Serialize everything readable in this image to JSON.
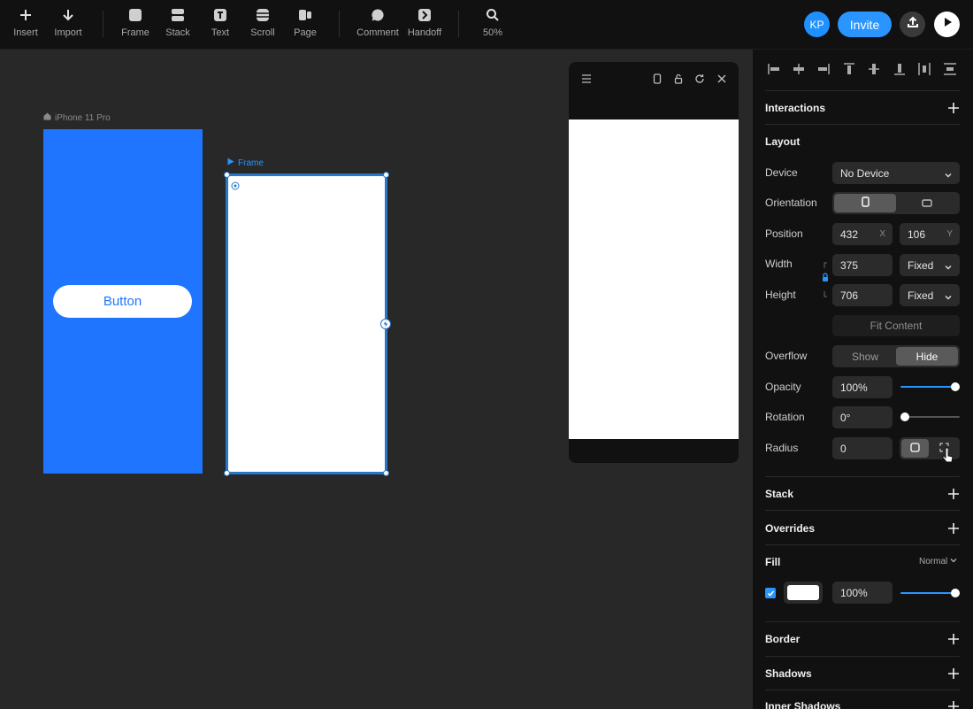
{
  "toolbar": {
    "insert": "Insert",
    "import": "Import",
    "frame": "Frame",
    "stack": "Stack",
    "text": "Text",
    "scroll": "Scroll",
    "page": "Page",
    "comment": "Comment",
    "handoff": "Handoff",
    "zoom": "50%",
    "avatar_initials": "KP",
    "invite": "Invite"
  },
  "canvas": {
    "iphone_frame_title": "iPhone 11 Pro",
    "button_label": "Button",
    "selected_frame_title": "Frame"
  },
  "panel": {
    "interactions": "Interactions",
    "layout": "Layout",
    "device_label": "Device",
    "device_value": "No Device",
    "orientation_label": "Orientation",
    "position_label": "Position",
    "position_x": "432",
    "position_x_suffix": "X",
    "position_y": "106",
    "position_y_suffix": "Y",
    "width_label": "Width",
    "width_value": "375",
    "width_mode": "Fixed",
    "height_label": "Height",
    "height_value": "706",
    "height_mode": "Fixed",
    "fit_content": "Fit Content",
    "overflow_label": "Overflow",
    "overflow_show": "Show",
    "overflow_hide": "Hide",
    "opacity_label": "Opacity",
    "opacity_value": "100%",
    "opacity_level": 1.0,
    "rotation_label": "Rotation",
    "rotation_value": "0°",
    "rotation_level": 0,
    "radius_label": "Radius",
    "radius_value": "0",
    "stack": "Stack",
    "overrides": "Overrides",
    "fill": "Fill",
    "fill_blend": "Normal",
    "fill_color": "#ffffff",
    "fill_opacity": "100%",
    "fill_opacity_level": 1.0,
    "border": "Border",
    "shadows": "Shadows",
    "inner_shadows": "Inner Shadows"
  },
  "colors": {
    "accent": "#2a95ff",
    "frame_blue": "#1f75fe",
    "selection": "#2a77c9"
  }
}
